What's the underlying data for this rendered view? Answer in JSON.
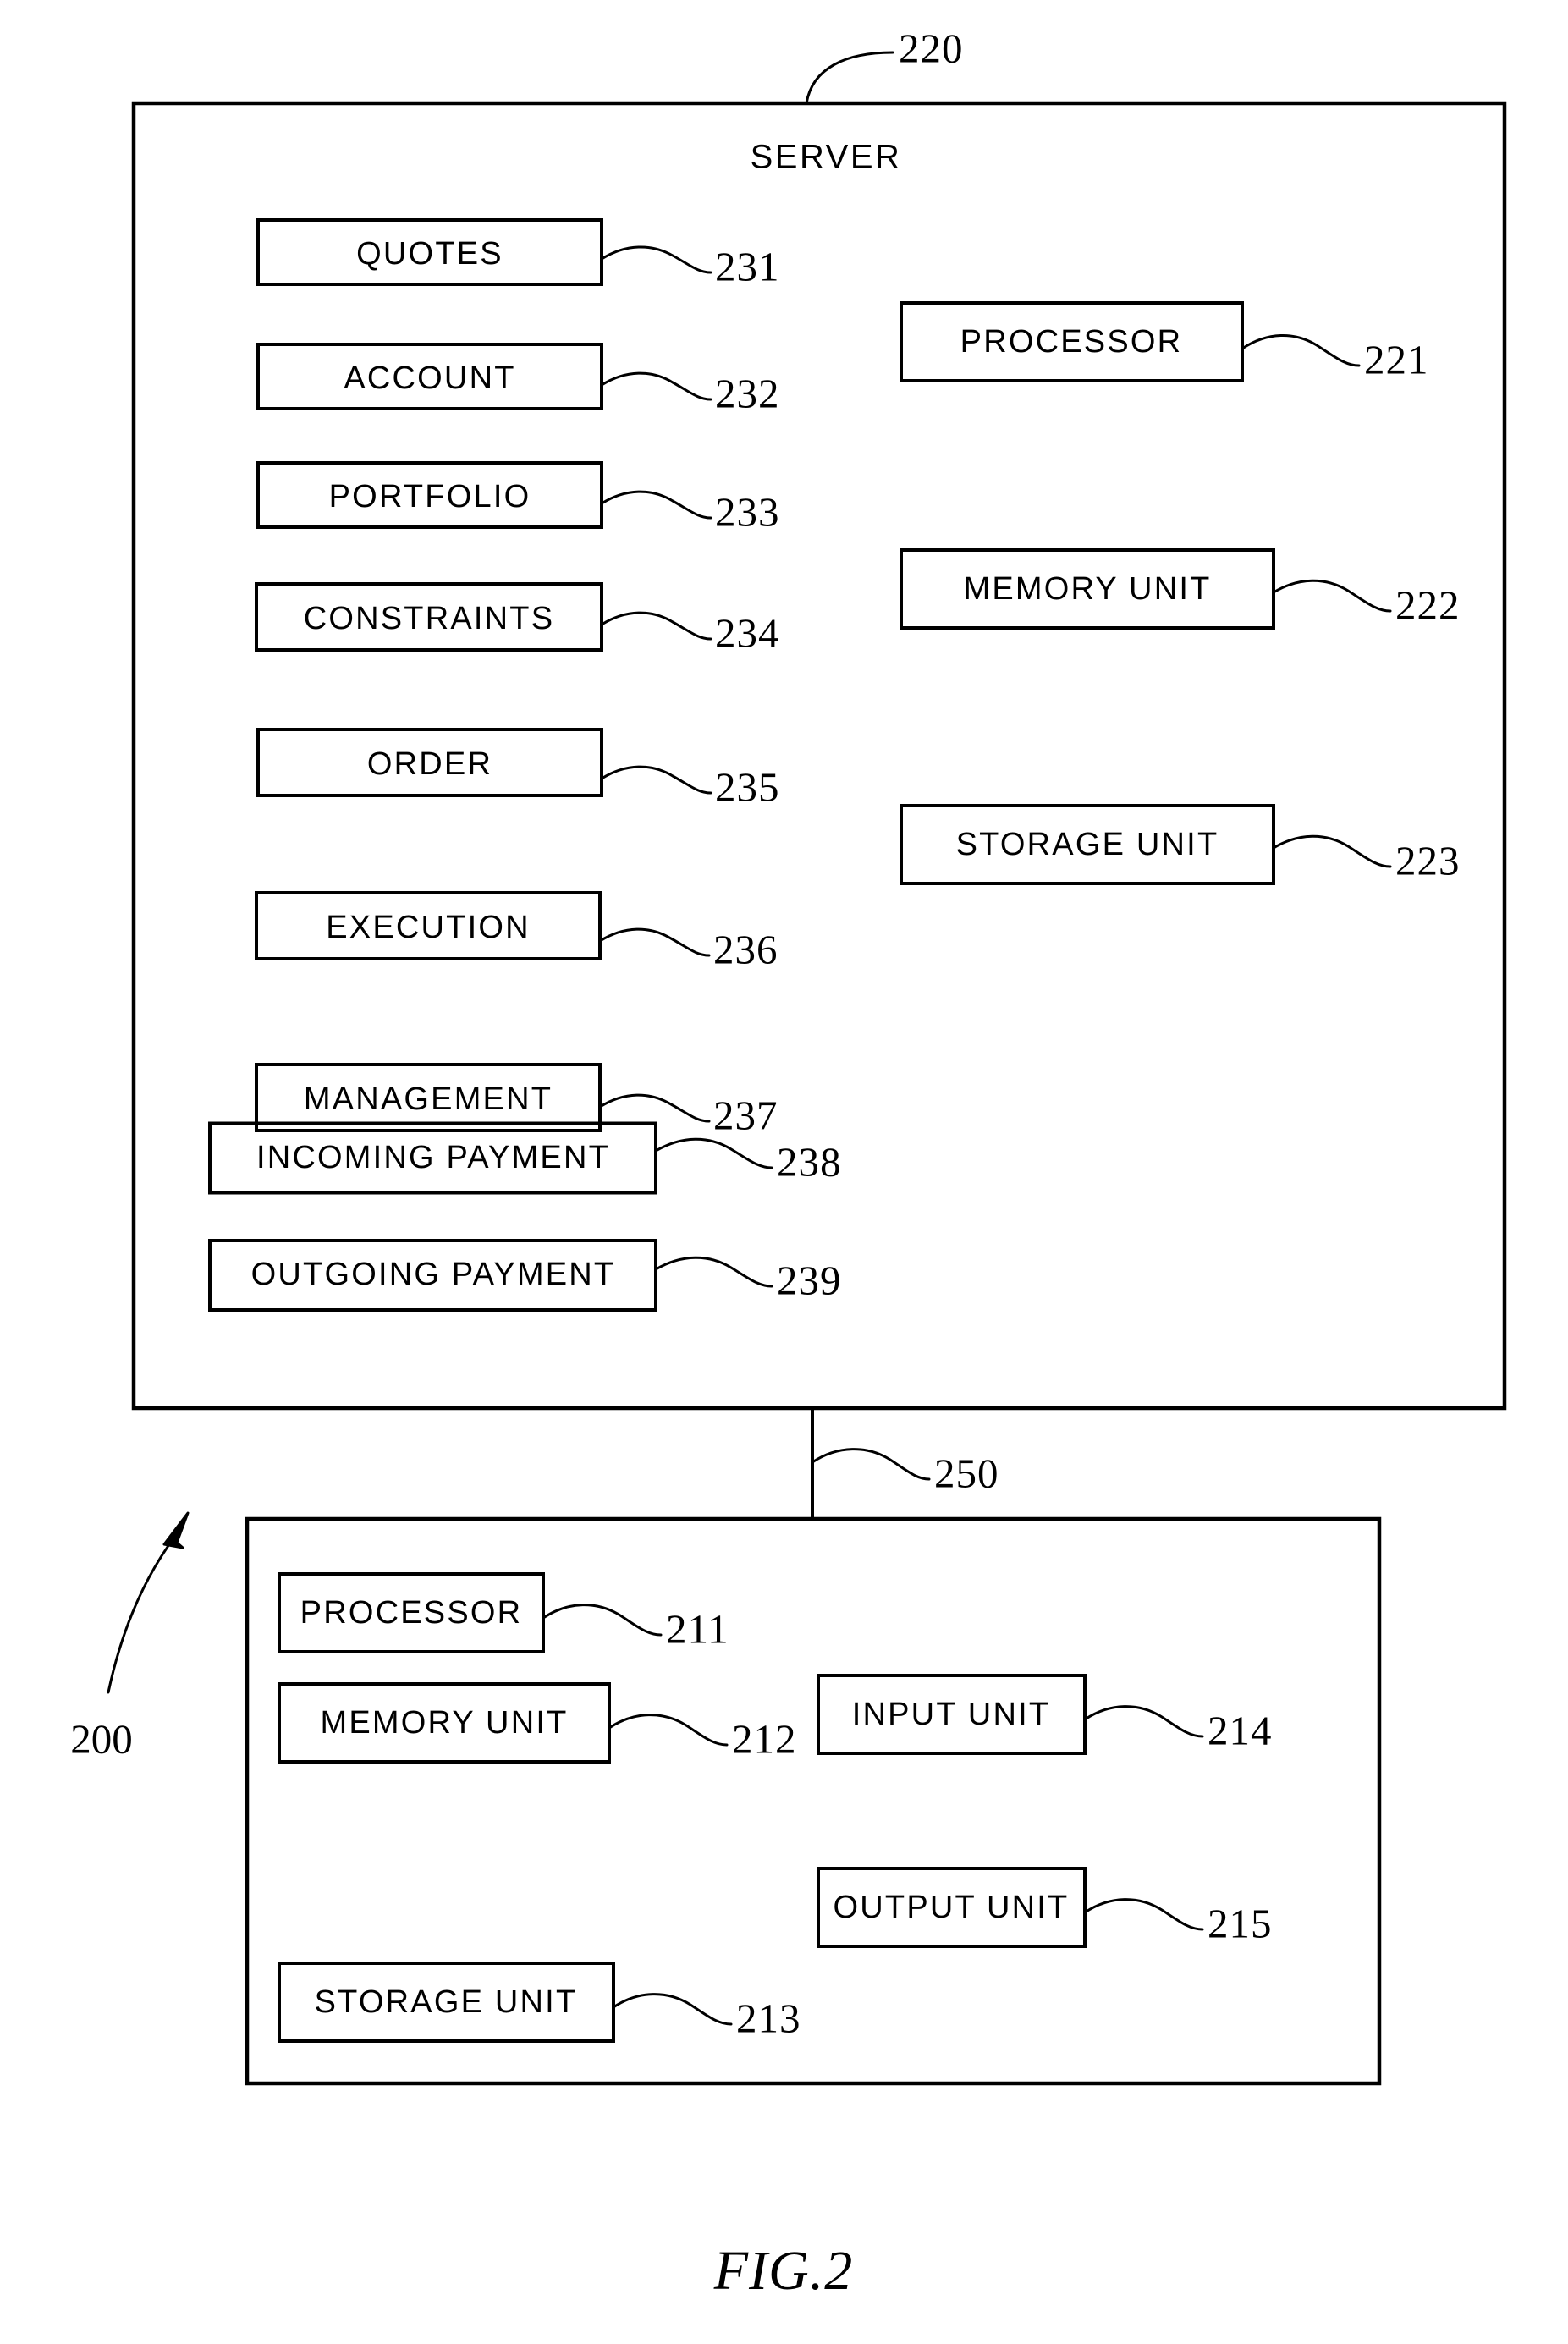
{
  "figure": {
    "caption": "FIG.2",
    "system_ref": "200"
  },
  "server": {
    "title": "SERVER",
    "ref": "220",
    "modules": [
      {
        "label": "QUOTES",
        "ref": "231"
      },
      {
        "label": "ACCOUNT",
        "ref": "232"
      },
      {
        "label": "PORTFOLIO",
        "ref": "233"
      },
      {
        "label": "CONSTRAINTS",
        "ref": "234"
      },
      {
        "label": "ORDER",
        "ref": "235"
      },
      {
        "label": "EXECUTION",
        "ref": "236"
      },
      {
        "label": "MANAGEMENT",
        "ref": "237"
      },
      {
        "label": "INCOMING PAYMENT",
        "ref": "238"
      },
      {
        "label": "OUTGOING PAYMENT",
        "ref": "239"
      }
    ],
    "hardware": [
      {
        "label": "PROCESSOR",
        "ref": "221"
      },
      {
        "label": "MEMORY UNIT",
        "ref": "222"
      },
      {
        "label": "STORAGE UNIT",
        "ref": "223"
      }
    ]
  },
  "network": {
    "ref": "250"
  },
  "client": {
    "left_units": [
      {
        "label": "PROCESSOR",
        "ref": "211"
      },
      {
        "label": "MEMORY UNIT",
        "ref": "212"
      },
      {
        "label": "STORAGE UNIT",
        "ref": "213"
      }
    ],
    "right_units": [
      {
        "label": "INPUT UNIT",
        "ref": "214"
      },
      {
        "label": "OUTPUT UNIT",
        "ref": "215"
      }
    ]
  }
}
